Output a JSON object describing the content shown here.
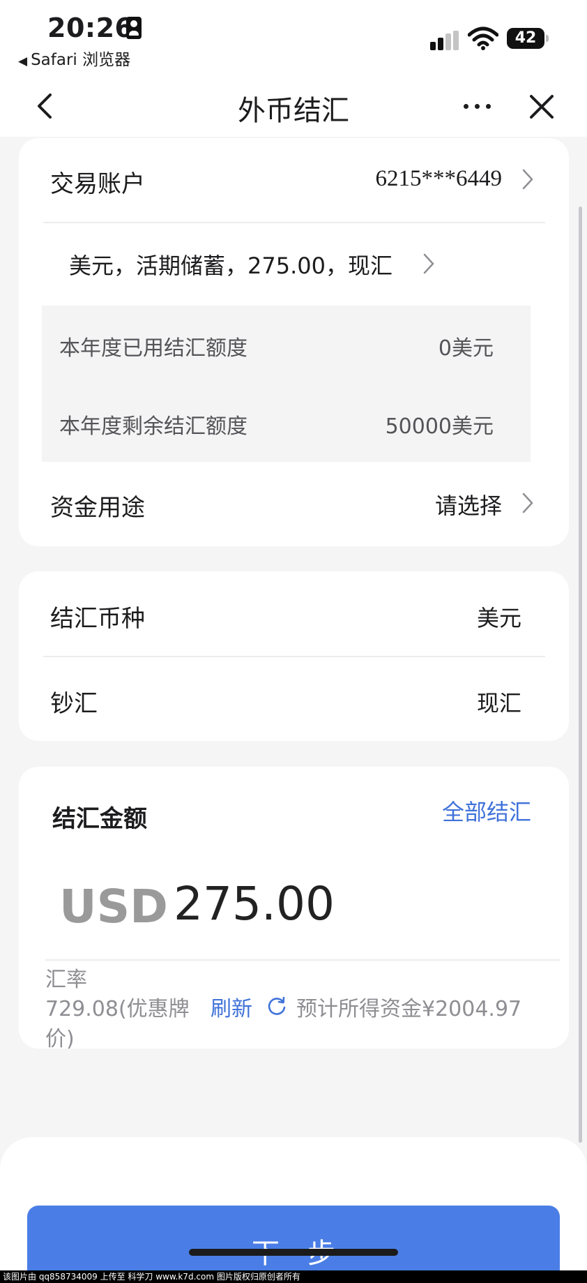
{
  "status_bar": {
    "time": "20:26",
    "back_app": "Safari 浏览器",
    "battery": "42"
  },
  "nav": {
    "title": "外币结汇"
  },
  "account_card": {
    "account_label": "交易账户",
    "account_number": "6215***6449",
    "account_detail": "美元，活期储蓄，275.00，现汇",
    "used_quota_label": "本年度已用结汇额度",
    "used_quota_value": "0美元",
    "remaining_quota_label": "本年度剩余结汇额度",
    "remaining_quota_value": "50000美元",
    "purpose_label": "资金用途",
    "purpose_value": "请选择"
  },
  "currency_card": {
    "currency_label": "结汇币种",
    "currency_value": "美元",
    "cash_remit_label": "钞汇",
    "cash_remit_value": "现汇"
  },
  "amount_card": {
    "title": "结汇金额",
    "all_link": "全部结汇",
    "currency_code": "USD",
    "amount": "275.00",
    "rate_label": "汇率",
    "rate_value_line1": "729.08(优惠牌",
    "rate_value_line2": "价)",
    "refresh_label": "刷新",
    "expected_text": "预计所得资金¥2004.97"
  },
  "footer": {
    "next_button": "下一步",
    "watermark": "该图片由 qq858734009 上传至 科学刀 www.k7d.com 图片版权归原创者所有"
  },
  "colors": {
    "accent": "#4a7ee6",
    "link": "#3f72d9",
    "background": "#f5f5f6"
  }
}
